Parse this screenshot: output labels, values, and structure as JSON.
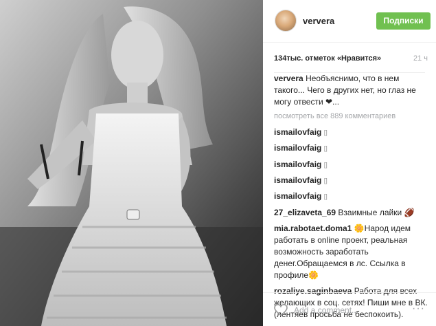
{
  "post": {
    "username": "ververa",
    "follow_label": "Подписки",
    "likes": "134тыс. отметок «Нравится»",
    "time": "21 ч"
  },
  "caption": {
    "user": "ververa",
    "text": "Необъяснимо, что в нем такого... Чего в других нет, но глаз не могу отвести ❤..."
  },
  "view_all": "посмотреть все 889 комментариев",
  "comments": [
    {
      "user": "ismailovfaig",
      "text": "[]"
    },
    {
      "user": "ismailovfaig",
      "text": "[]"
    },
    {
      "user": "ismailovfaig",
      "text": "[]"
    },
    {
      "user": "ismailovfaig",
      "text": "[]"
    },
    {
      "user": "ismailovfaig",
      "text": "[]"
    },
    {
      "user": "27_elizaveta_69",
      "text": "Взаимные лайки 🏈"
    },
    {
      "user": "mia.rabotaet.doma1",
      "text": "🌼Народ идем работать в online проект, реальная возможность заработать денег.Обращаемся в лс. Ссылка в профиле🌼"
    },
    {
      "user": "rozaliye.saginbaeva",
      "text": "Работа для всех желающих в соц. сетях! Пиши мне в ВК. (лентяев просьба не беспокоить)."
    }
  ],
  "add_comment": {
    "placeholder": "Add a comment...",
    "more": "···"
  },
  "icons": {
    "heart": "heart-icon",
    "more": "more-options-icon"
  },
  "colors": {
    "follow_button": "#70c050",
    "muted_text": "#a5a7aa"
  }
}
